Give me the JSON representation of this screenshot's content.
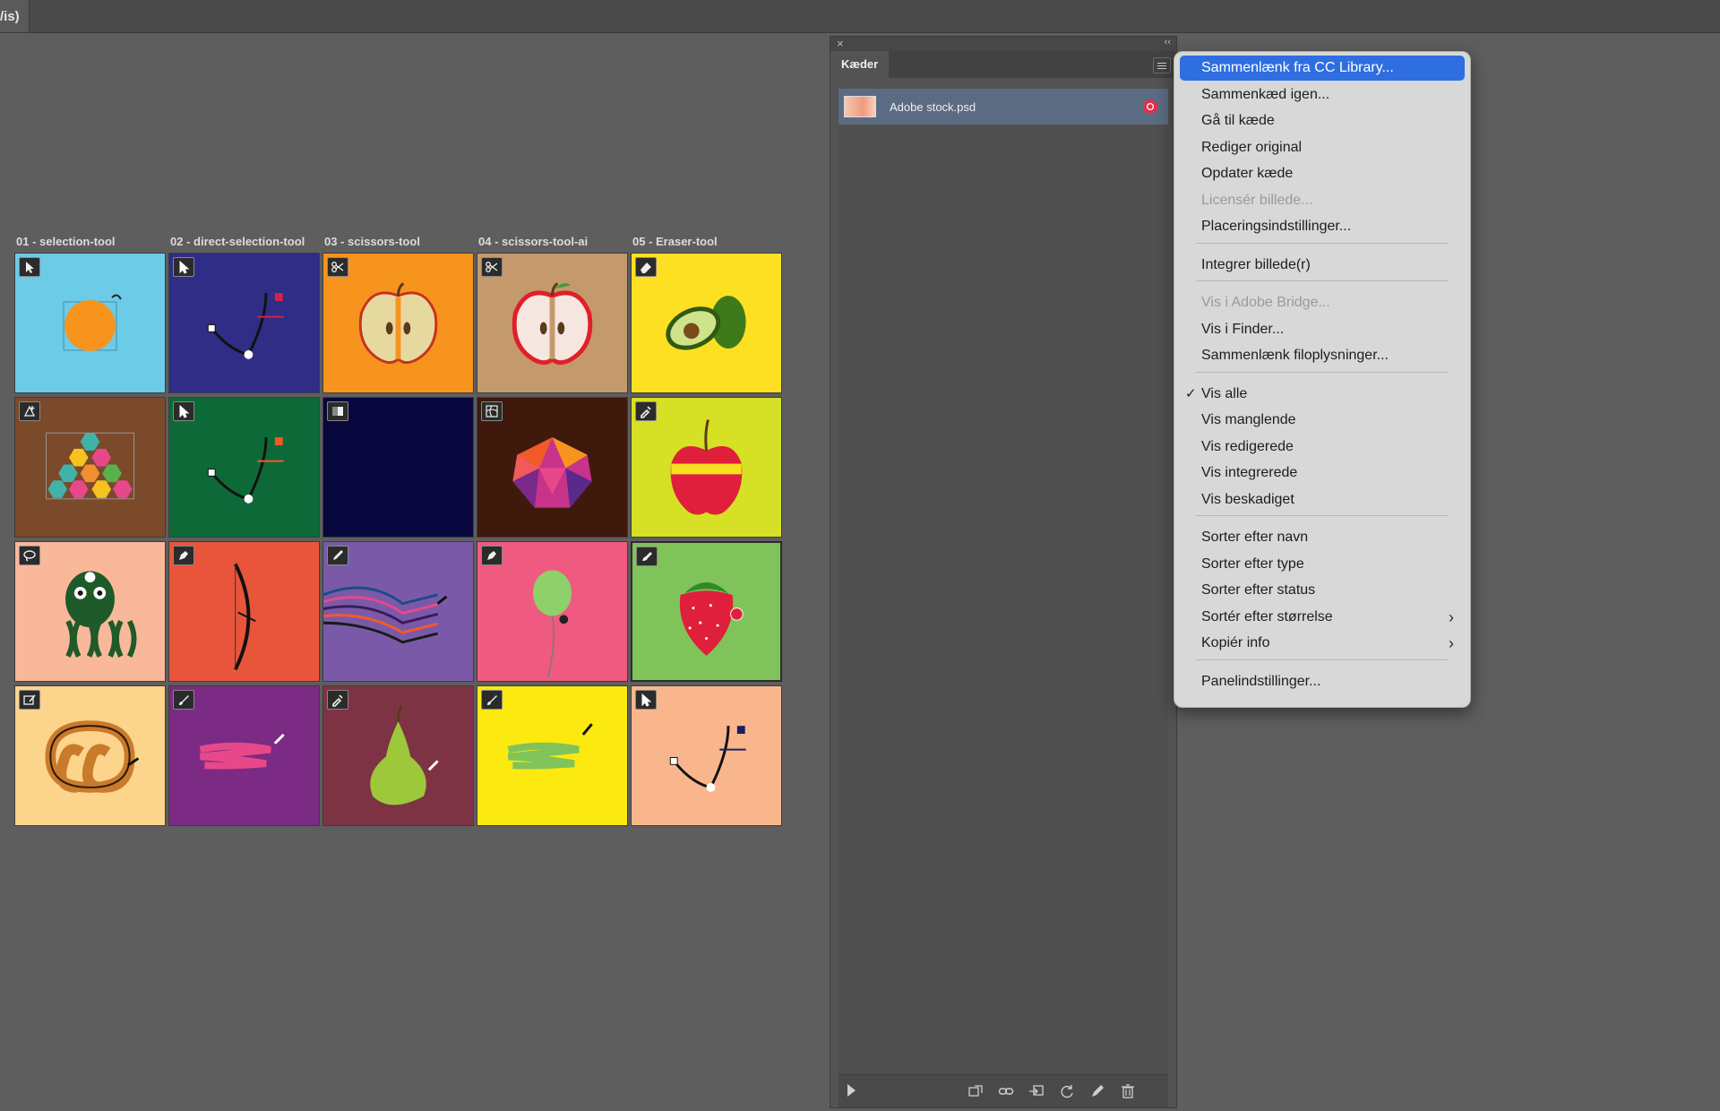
{
  "topbar": {
    "doc_tab": "/is)"
  },
  "artboards": {
    "labels": [
      "01 - selection-tool",
      "02 - direct-selection-tool",
      "03 - scissors-tool",
      "04 - scissors-tool-ai",
      "05 - Eraser-tool"
    ]
  },
  "tiles": [
    {
      "bg": "#6ccbe6",
      "tool": "selection-tool",
      "art": "orange"
    },
    {
      "bg": "#2f2d86",
      "tool": "direct-selection-tool",
      "art": "path-red"
    },
    {
      "bg": "#f7941e",
      "tool": "scissors-tool",
      "art": "apple-half"
    },
    {
      "bg": "#c49a6c",
      "tool": "scissors-tool",
      "art": "apple-half-red"
    },
    {
      "bg": "#fde021",
      "tool": "eraser-tool",
      "art": "avocado"
    },
    {
      "bg": "#7a4a2a",
      "tool": "perspective-tool",
      "art": "hexagons"
    },
    {
      "bg": "#0d6a38",
      "tool": "direct-selection-tool",
      "art": "path-orange"
    },
    {
      "bg": "#07073d",
      "tool": "gradient-tool",
      "art": "none"
    },
    {
      "bg": "#3f1a0c",
      "tool": "mesh-tool",
      "art": "gem"
    },
    {
      "bg": "#d6e024",
      "tool": "eyedropper-tool",
      "art": "apple"
    },
    {
      "bg": "#f9b89a",
      "tool": "lasso-tool",
      "art": "octopus"
    },
    {
      "bg": "#e8553a",
      "tool": "pen-tool",
      "art": "bow"
    },
    {
      "bg": "#7a5aa8",
      "tool": "pencil-tool",
      "art": "strings"
    },
    {
      "bg": "#ef5a80",
      "tool": "pen-tool",
      "art": "balloon"
    },
    {
      "bg": "#7fc35a",
      "tool": "blob-brush-tool",
      "art": "strawberry"
    },
    {
      "bg": "#fcd48c",
      "tool": "shaper-tool",
      "art": "pretzel"
    },
    {
      "bg": "#7b2b84",
      "tool": "paintbrush-tool",
      "art": "pink-stroke"
    },
    {
      "bg": "#7e3345",
      "tool": "eyedropper-tool",
      "art": "pear"
    },
    {
      "bg": "#fbe90f",
      "tool": "paintbrush-tool",
      "art": "green-stroke"
    },
    {
      "bg": "#f9b68c",
      "tool": "direct-selection-tool",
      "art": "path-navy"
    }
  ],
  "links_panel": {
    "tab": "Kæder",
    "items": [
      {
        "name": "Adobe stock.psd"
      }
    ]
  },
  "context_menu": {
    "items": [
      {
        "label": "Sammenlænk fra CC Library...",
        "state": "highlighted"
      },
      {
        "label": "Sammenkæd igen...",
        "state": "normal"
      },
      {
        "label": "Gå til kæde",
        "state": "normal"
      },
      {
        "label": "Rediger original",
        "state": "normal"
      },
      {
        "label": "Opdater kæde",
        "state": "normal"
      },
      {
        "label": "Licensér billede...",
        "state": "disabled"
      },
      {
        "label": "Placeringsindstillinger...",
        "state": "normal"
      },
      {
        "label": "Integrer billede(r)",
        "state": "normal"
      },
      {
        "label": "Vis i Adobe Bridge...",
        "state": "disabled"
      },
      {
        "label": "Vis i Finder...",
        "state": "normal"
      },
      {
        "label": "Sammenlænk filoplysninger...",
        "state": "normal"
      },
      {
        "label": "Vis alle",
        "state": "checked"
      },
      {
        "label": "Vis manglende",
        "state": "normal"
      },
      {
        "label": "Vis redigerede",
        "state": "normal"
      },
      {
        "label": "Vis integrerede",
        "state": "normal"
      },
      {
        "label": "Vis beskadiget",
        "state": "normal"
      },
      {
        "label": "Sorter efter navn",
        "state": "normal"
      },
      {
        "label": "Sorter efter type",
        "state": "normal"
      },
      {
        "label": "Sorter efter status",
        "state": "normal"
      },
      {
        "label": "Sortér efter størrelse",
        "state": "submenu"
      },
      {
        "label": "Kopiér info",
        "state": "submenu"
      },
      {
        "label": "Panelindstillinger...",
        "state": "normal"
      }
    ],
    "check_glyph": "✓",
    "submenu_glyph": "›"
  },
  "colors": {
    "highlight": "#2f6ee1",
    "panel": "#535353",
    "canvas": "#5e5e5e"
  }
}
